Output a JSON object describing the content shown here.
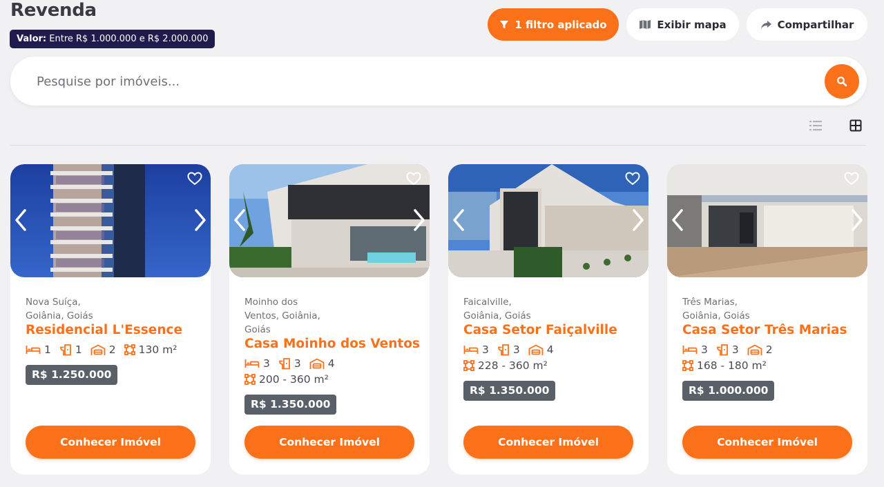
{
  "header": {
    "title": "Revenda",
    "filter_badge": {
      "key": "Valor:",
      "value": "Entre R$ 1.000.000 e R$ 2.000.000"
    },
    "filter_button": "1 filtro aplicado",
    "map_button": "Exibir mapa",
    "share_button": "Compartilhar"
  },
  "search": {
    "placeholder": "Pesquise por imóveis..."
  },
  "colors": {
    "accent": "#fb7119",
    "badge": "#1f1b4d",
    "price_bg": "#5a6068"
  },
  "listings": [
    {
      "location_line1": "Nova Suíça,",
      "location_line2": "Goiânia, Goiás",
      "location_line3": "",
      "name": "Residencial L'Essence",
      "bedrooms": "1",
      "bathrooms": "1",
      "garages": "2",
      "area": "130 m²",
      "price": "R$ 1.250.000",
      "cta": "Conhecer Imóvel"
    },
    {
      "location_line1": "Moinho dos",
      "location_line2": "Ventos, Goiânia,",
      "location_line3": "Goiás",
      "name": "Casa Moinho dos Ventos",
      "bedrooms": "3",
      "bathrooms": "3",
      "garages": "4",
      "area": "200 - 360 m²",
      "price": "R$ 1.350.000",
      "cta": "Conhecer Imóvel"
    },
    {
      "location_line1": "Faicalville,",
      "location_line2": "Goiânia, Goiás",
      "location_line3": "",
      "name": "Casa Setor Faiçalville",
      "bedrooms": "3",
      "bathrooms": "3",
      "garages": "4",
      "area": "228 - 360 m²",
      "price": "R$ 1.350.000",
      "cta": "Conhecer Imóvel"
    },
    {
      "location_line1": "Três Marias,",
      "location_line2": "Goiânia, Goiás",
      "location_line3": "",
      "name": "Casa Setor Três Marias",
      "bedrooms": "3",
      "bathrooms": "3",
      "garages": "2",
      "area": "168 - 180 m²",
      "price": "R$ 1.000.000",
      "cta": "Conhecer Imóvel"
    }
  ]
}
